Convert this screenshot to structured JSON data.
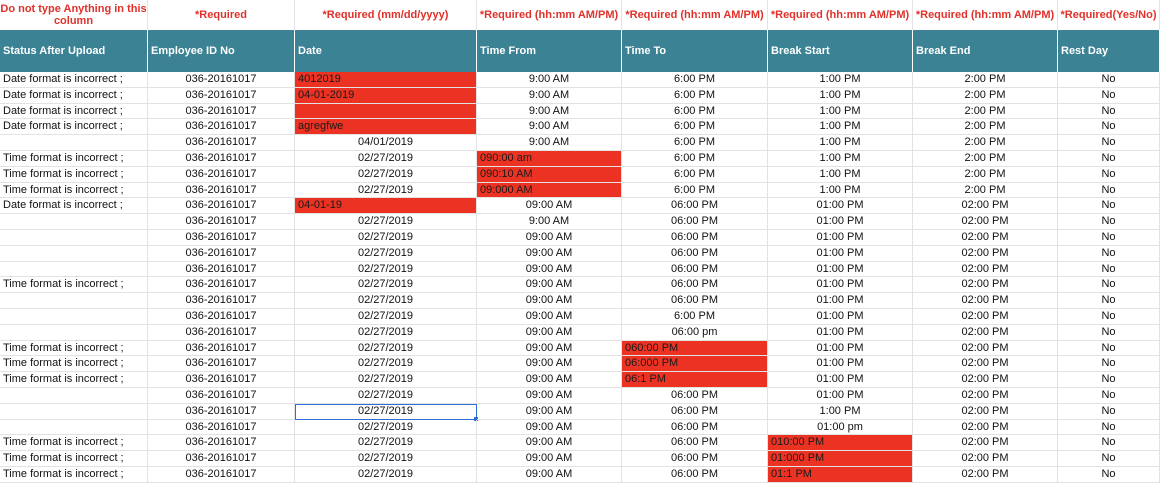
{
  "requirements": [
    "Do not type Anything in this column",
    "*Required",
    "*Required (mm/dd/yyyy)",
    "*Required  (hh:mm AM/PM)",
    "*Required  (hh:mm AM/PM)",
    "*Required  (hh:mm AM/PM)",
    "*Required  (hh:mm AM/PM)",
    "*Required(Yes/No)"
  ],
  "headers": [
    "Status After Upload",
    "Employee ID No",
    "Date",
    "Time From",
    "Time To",
    "Break Start",
    "Break End",
    "Rest Day"
  ],
  "highlight_color": "#ec3323",
  "header_color": "#3a8294",
  "selected_cell": {
    "row": 21,
    "col": 2
  },
  "rows": [
    {
      "status": "Date format is incorrect ;",
      "id": "036-20161017",
      "date": "4012019",
      "from": "9:00 AM",
      "to": "6:00 PM",
      "bstart": "1:00 PM",
      "bend": "2:00 PM",
      "rest": "No",
      "bad": [
        "date"
      ]
    },
    {
      "status": "Date format is incorrect ;",
      "id": "036-20161017",
      "date": "04-01-2019",
      "from": "9:00 AM",
      "to": "6:00 PM",
      "bstart": "1:00 PM",
      "bend": "2:00 PM",
      "rest": "No",
      "bad": [
        "date"
      ]
    },
    {
      "status": "Date format is incorrect ;",
      "id": "036-20161017",
      "date": "",
      "from": "9:00 AM",
      "to": "6:00 PM",
      "bstart": "1:00 PM",
      "bend": "2:00 PM",
      "rest": "No",
      "bad": [
        "date"
      ]
    },
    {
      "status": "Date format is incorrect ;",
      "id": "036-20161017",
      "date": "agregfwe",
      "from": "9:00 AM",
      "to": "6:00 PM",
      "bstart": "1:00 PM",
      "bend": "2:00 PM",
      "rest": "No",
      "bad": [
        "date"
      ]
    },
    {
      "status": "",
      "id": "036-20161017",
      "date": "04/01/2019",
      "from": "9:00 AM",
      "to": "6:00 PM",
      "bstart": "1:00 PM",
      "bend": "2:00 PM",
      "rest": "No",
      "bad": []
    },
    {
      "status": "Time format is incorrect ;",
      "id": "036-20161017",
      "date": "02/27/2019",
      "from": "090:00 am",
      "to": "6:00 PM",
      "bstart": "1:00 PM",
      "bend": "2:00 PM",
      "rest": "No",
      "bad": [
        "from"
      ]
    },
    {
      "status": "Time format is incorrect ;",
      "id": "036-20161017",
      "date": "02/27/2019",
      "from": "090:10 AM",
      "to": "6:00 PM",
      "bstart": "1:00 PM",
      "bend": "2:00 PM",
      "rest": "No",
      "bad": [
        "from"
      ]
    },
    {
      "status": "Time format is incorrect ;",
      "id": "036-20161017",
      "date": "02/27/2019",
      "from": "09:000 AM",
      "to": "6:00 PM",
      "bstart": "1:00 PM",
      "bend": "2:00 PM",
      "rest": "No",
      "bad": [
        "from"
      ]
    },
    {
      "status": "Date format is incorrect ;",
      "id": "036-20161017",
      "date": "04-01-19",
      "from": "09:00 AM",
      "to": "06:00 PM",
      "bstart": "01:00 PM",
      "bend": "02:00 PM",
      "rest": "No",
      "bad": [
        "date"
      ]
    },
    {
      "status": "",
      "id": "036-20161017",
      "date": "02/27/2019",
      "from": "9:00 AM",
      "to": "06:00 PM",
      "bstart": "01:00 PM",
      "bend": "02:00 PM",
      "rest": "No",
      "bad": []
    },
    {
      "status": "",
      "id": "036-20161017",
      "date": "02/27/2019",
      "from": "09:00 AM",
      "to": "06:00 PM",
      "bstart": "01:00 PM",
      "bend": "02:00 PM",
      "rest": "No",
      "bad": []
    },
    {
      "status": "",
      "id": "036-20161017",
      "date": "02/27/2019",
      "from": "09:00 AM",
      "to": "06:00 PM",
      "bstart": "01:00 PM",
      "bend": "02:00 PM",
      "rest": "No",
      "bad": []
    },
    {
      "status": "",
      "id": "036-20161017",
      "date": "02/27/2019",
      "from": "09:00 AM",
      "to": "06:00 PM",
      "bstart": "01:00 PM",
      "bend": "02:00 PM",
      "rest": "No",
      "bad": []
    },
    {
      "status": "Time format is incorrect ;",
      "id": "036-20161017",
      "date": "02/27/2019",
      "from": "09:00 AM",
      "to": "06:00 PM",
      "bstart": "01:00 PM",
      "bend": "02:00 PM",
      "rest": "No",
      "bad": []
    },
    {
      "status": "",
      "id": "036-20161017",
      "date": "02/27/2019",
      "from": "09:00 AM",
      "to": "06:00 PM",
      "bstart": "01:00 PM",
      "bend": "02:00 PM",
      "rest": "No",
      "bad": []
    },
    {
      "status": "",
      "id": "036-20161017",
      "date": "02/27/2019",
      "from": "09:00 AM",
      "to": "6:00 PM",
      "bstart": "01:00 PM",
      "bend": "02:00 PM",
      "rest": "No",
      "bad": []
    },
    {
      "status": "",
      "id": "036-20161017",
      "date": "02/27/2019",
      "from": "09:00 AM",
      "to": "06:00 pm",
      "bstart": "01:00 PM",
      "bend": "02:00 PM",
      "rest": "No",
      "bad": []
    },
    {
      "status": "Time format is incorrect ;",
      "id": "036-20161017",
      "date": "02/27/2019",
      "from": "09:00 AM",
      "to": "060:00 PM",
      "bstart": "01:00 PM",
      "bend": "02:00 PM",
      "rest": "No",
      "bad": [
        "to"
      ]
    },
    {
      "status": "Time format is incorrect ;",
      "id": "036-20161017",
      "date": "02/27/2019",
      "from": "09:00 AM",
      "to": "06:000 PM",
      "bstart": "01:00 PM",
      "bend": "02:00 PM",
      "rest": "No",
      "bad": [
        "to"
      ]
    },
    {
      "status": "Time format is incorrect ;",
      "id": "036-20161017",
      "date": "02/27/2019",
      "from": "09:00 AM",
      "to": "06:1 PM",
      "bstart": "01:00 PM",
      "bend": "02:00 PM",
      "rest": "No",
      "bad": [
        "to"
      ]
    },
    {
      "status": "",
      "id": "036-20161017",
      "date": "02/27/2019",
      "from": "09:00 AM",
      "to": "06:00 PM",
      "bstart": "01:00 PM",
      "bend": "02:00 PM",
      "rest": "No",
      "bad": []
    },
    {
      "status": "",
      "id": "036-20161017",
      "date": "02/27/2019",
      "from": "09:00 AM",
      "to": "06:00 PM",
      "bstart": "1:00 PM",
      "bend": "02:00 PM",
      "rest": "No",
      "bad": []
    },
    {
      "status": "",
      "id": "036-20161017",
      "date": "02/27/2019",
      "from": "09:00 AM",
      "to": "06:00 PM",
      "bstart": "01:00 pm",
      "bend": "02:00 PM",
      "rest": "No",
      "bad": []
    },
    {
      "status": "Time format is incorrect ;",
      "id": "036-20161017",
      "date": "02/27/2019",
      "from": "09:00 AM",
      "to": "06:00 PM",
      "bstart": "010:00 PM",
      "bend": "02:00 PM",
      "rest": "No",
      "bad": [
        "bstart"
      ]
    },
    {
      "status": "Time format is incorrect ;",
      "id": "036-20161017",
      "date": "02/27/2019",
      "from": "09:00 AM",
      "to": "06:00 PM",
      "bstart": "01:000 PM",
      "bend": "02:00 PM",
      "rest": "No",
      "bad": [
        "bstart"
      ]
    },
    {
      "status": "Time format is incorrect ;",
      "id": "036-20161017",
      "date": "02/27/2019",
      "from": "09:00 AM",
      "to": "06:00 PM",
      "bstart": "01:1 PM",
      "bend": "02:00 PM",
      "rest": "No",
      "bad": [
        "bstart"
      ]
    }
  ]
}
